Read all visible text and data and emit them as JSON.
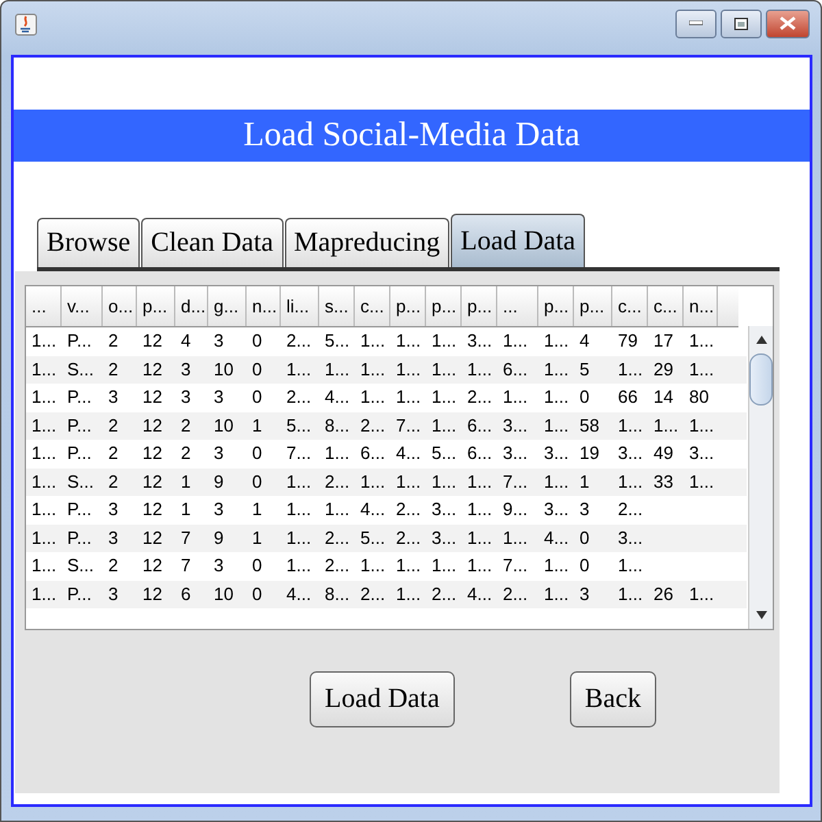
{
  "banner": {
    "title": "Load Social-Media Data"
  },
  "tabs": [
    {
      "label": "Browse",
      "selected": false
    },
    {
      "label": "Clean Data",
      "selected": false
    },
    {
      "label": "Mapreducing",
      "selected": false
    },
    {
      "label": "Load Data",
      "selected": true
    }
  ],
  "table": {
    "columns": [
      "...",
      "v...",
      "o...",
      "p...",
      "d...",
      "g...",
      "n...",
      "li...",
      "s...",
      "c...",
      "p...",
      "p...",
      "p...",
      "...",
      "p...",
      "p...",
      "c...",
      "c...",
      "n..."
    ],
    "rows": [
      [
        "1...",
        "P...",
        "2",
        "12",
        "4",
        "3",
        "0",
        "2...",
        "5...",
        "1...",
        "1...",
        "1...",
        "3...",
        "1...",
        "1...",
        "4",
        "79",
        "17",
        "1..."
      ],
      [
        "1...",
        "S...",
        "2",
        "12",
        "3",
        "10",
        "0",
        "1...",
        "1...",
        "1...",
        "1...",
        "1...",
        "1...",
        "6...",
        "1...",
        "5",
        "1...",
        "29",
        "1..."
      ],
      [
        "1...",
        "P...",
        "3",
        "12",
        "3",
        "3",
        "0",
        "2...",
        "4...",
        "1...",
        "1...",
        "1...",
        "2...",
        "1...",
        "1...",
        "0",
        "66",
        "14",
        "80"
      ],
      [
        "1...",
        "P...",
        "2",
        "12",
        "2",
        "10",
        "1",
        "5...",
        "8...",
        "2...",
        "7...",
        "1...",
        "6...",
        "3...",
        "1...",
        "58",
        "1...",
        "1...",
        "1..."
      ],
      [
        "1...",
        "P...",
        "2",
        "12",
        "2",
        "3",
        "0",
        "7...",
        "1...",
        "6...",
        "4...",
        "5...",
        "6...",
        "3...",
        "3...",
        "19",
        "3...",
        "49",
        "3..."
      ],
      [
        "1...",
        "S...",
        "2",
        "12",
        "1",
        "9",
        "0",
        "1...",
        "2...",
        "1...",
        "1...",
        "1...",
        "1...",
        "7...",
        "1...",
        "1",
        "1...",
        "33",
        "1..."
      ],
      [
        "1...",
        "P...",
        "3",
        "12",
        "1",
        "3",
        "1",
        "1...",
        "1...",
        "4...",
        "2...",
        "3...",
        "1...",
        "9...",
        "3...",
        "3",
        "2..."
      ],
      [
        "1...",
        "P...",
        "3",
        "12",
        "7",
        "9",
        "1",
        "1...",
        "2...",
        "5...",
        "2...",
        "3...",
        "1...",
        "1...",
        "4...",
        "0",
        "3..."
      ],
      [
        "1...",
        "S...",
        "2",
        "12",
        "7",
        "3",
        "0",
        "1...",
        "2...",
        "1...",
        "1...",
        "1...",
        "1...",
        "7...",
        "1...",
        "0",
        "1..."
      ],
      [
        "1...",
        "P...",
        "3",
        "12",
        "6",
        "10",
        "0",
        "4...",
        "8...",
        "2...",
        "1...",
        "2...",
        "4...",
        "2...",
        "1...",
        "3",
        "1...",
        "26",
        "1..."
      ]
    ]
  },
  "buttons": [
    "Load Data",
    "Back"
  ]
}
